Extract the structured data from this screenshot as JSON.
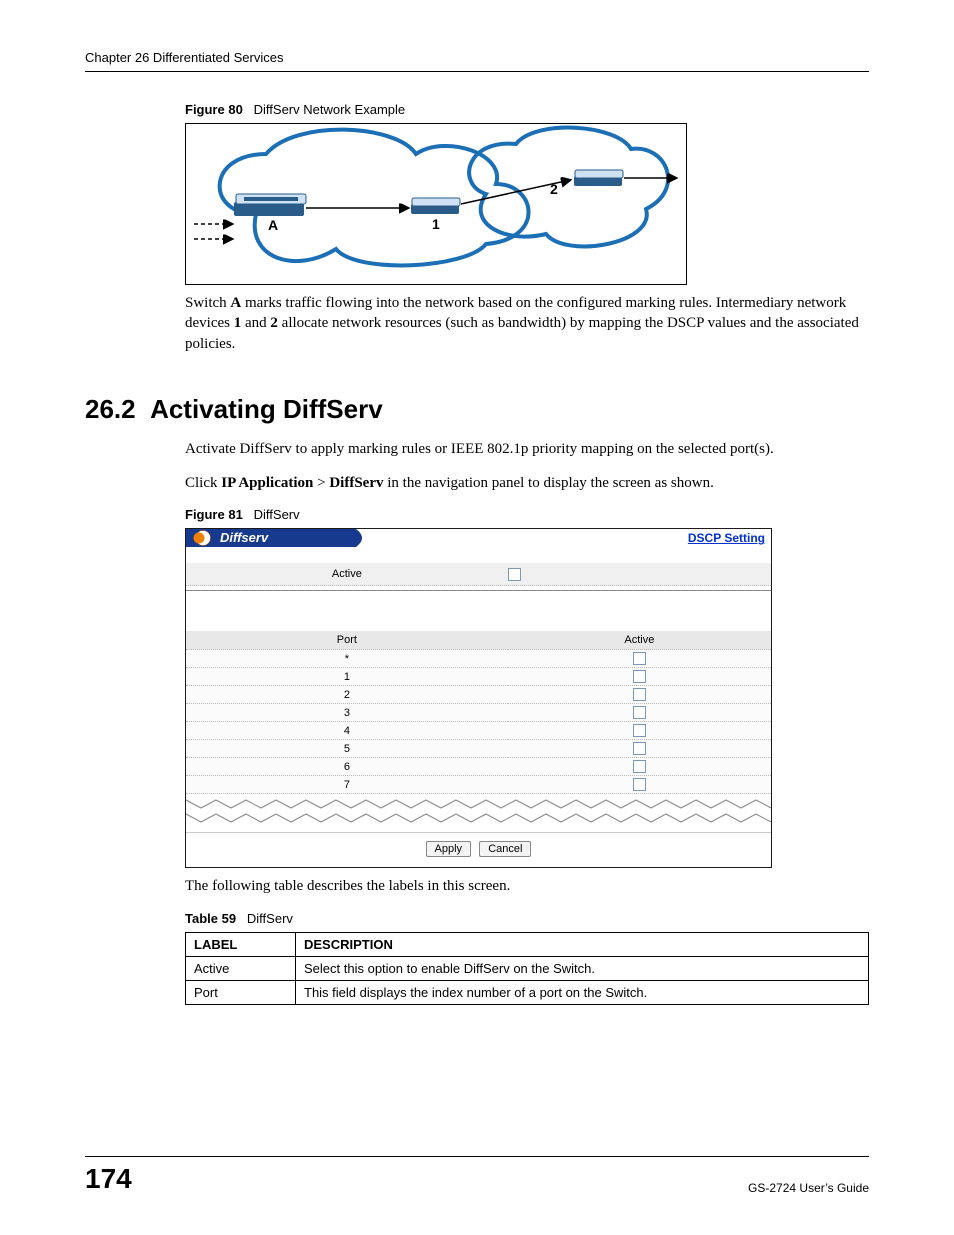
{
  "header": {
    "text": "Chapter 26 Differentiated Services"
  },
  "figure80": {
    "label": "Figure 80",
    "title": "DiffServ Network Example",
    "labels": {
      "A": "A",
      "one": "1",
      "two": "2"
    }
  },
  "para1": {
    "pre": "Switch ",
    "A": "A",
    "mid1": " marks traffic flowing into the network based on the configured marking rules. Intermediary network devices ",
    "one": "1",
    "mid2": " and ",
    "two": "2",
    "post": " allocate network resources (such as bandwidth) by mapping the DSCP values and the associated policies."
  },
  "section": {
    "num": "26.2",
    "title": "Activating DiffServ"
  },
  "para2": "Activate DiffServ to apply marking rules or IEEE 802.1p priority mapping on the selected port(s).",
  "para3": {
    "pre": "Click ",
    "b1": "IP Application",
    "gt": " > ",
    "b2": "DiffServ",
    "post": " in the navigation panel to display the screen as shown."
  },
  "figure81": {
    "label": "Figure 81",
    "title": "DiffServ",
    "widget_title": "Diffserv",
    "link": "DSCP Setting",
    "active_label": "Active",
    "table": {
      "col_port": "Port",
      "col_active": "Active",
      "rows": [
        "*",
        "1",
        "2",
        "3",
        "4",
        "5",
        "6",
        "7"
      ]
    },
    "buttons": {
      "apply": "Apply",
      "cancel": "Cancel"
    }
  },
  "para4": "The following table describes the labels in this screen.",
  "table59": {
    "label": "Table 59",
    "title": "DiffServ",
    "head": {
      "label": "LABEL",
      "desc": "DESCRIPTION"
    },
    "rows": [
      {
        "label": "Active",
        "desc": "Select this option to enable DiffServ on the Switch."
      },
      {
        "label": "Port",
        "desc": "This field displays the index number of a port on the Switch."
      }
    ]
  },
  "footer": {
    "page": "174",
    "guide": "GS-2724 User’s Guide"
  }
}
